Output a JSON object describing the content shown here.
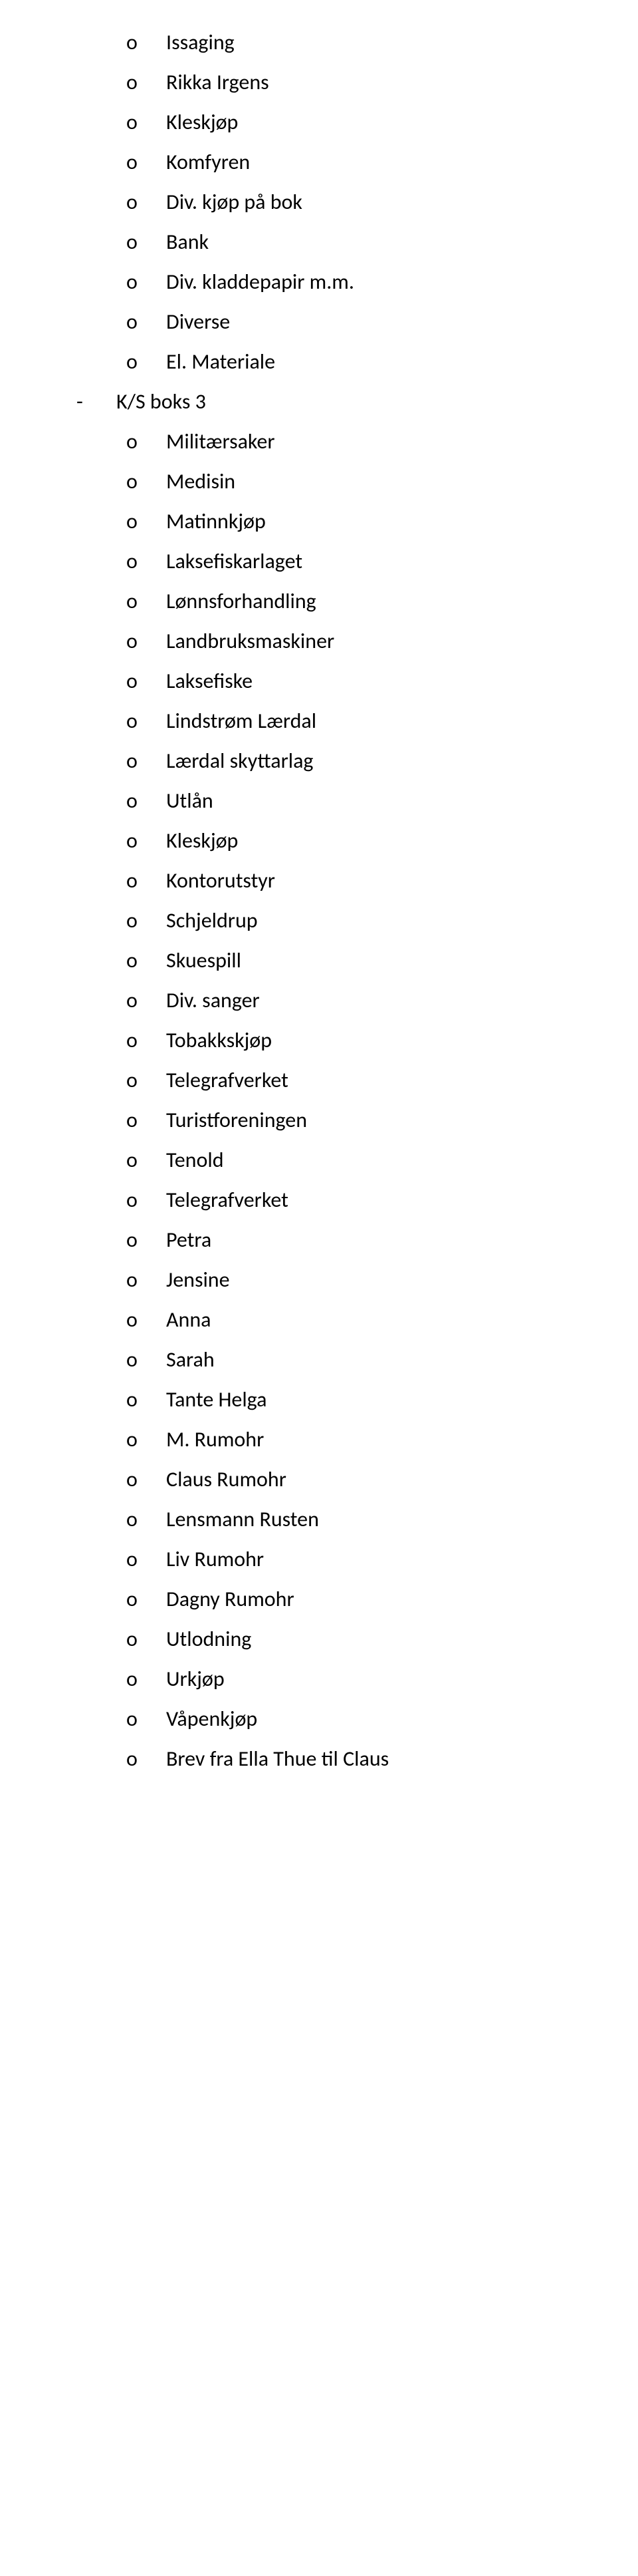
{
  "section_a": [
    "Issaging",
    "Rikka Irgens",
    "Kleskjøp",
    "Komfyren",
    "Div. kjøp på bok",
    "Bank",
    "Div. kladdepapir m.m.",
    "Diverse",
    "El. Materiale"
  ],
  "box_heading": "K/S boks 3",
  "section_b": [
    "Militærsaker",
    "Medisin",
    "Matinnkjøp",
    "Laksefiskarlaget",
    "Lønnsforhandling",
    "Landbruksmaskiner",
    "Laksefiske",
    "Lindstrøm Lærdal",
    "Lærdal skyttarlag",
    "Utlån",
    "Kleskjøp",
    "Kontorutstyr",
    "Schjeldrup",
    "Skuespill",
    "Div. sanger",
    "Tobakkskjøp",
    "Telegrafverket",
    "Turistforeningen",
    "Tenold",
    "Telegrafverket",
    "Petra",
    "Jensine",
    "Anna",
    "Sarah",
    "Tante Helga",
    "M. Rumohr",
    "Claus Rumohr",
    "Lensmann Rusten",
    "Liv Rumohr",
    "Dagny Rumohr",
    "Utlodning",
    "Urkjøp",
    "Våpenkjøp",
    "Brev fra Ella Thue til Claus"
  ],
  "bullet_char": "o",
  "dash_char": "-"
}
